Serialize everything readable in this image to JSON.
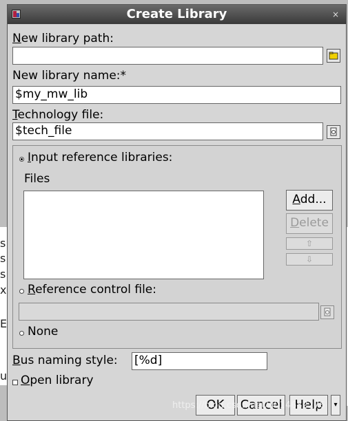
{
  "dialog": {
    "title": "Create Library",
    "close_glyph": "×",
    "new_library_path": {
      "label_first": "N",
      "label_rest": "ew library path:",
      "value": ""
    },
    "new_library_name": {
      "label": "New library name:*",
      "value": "$my_mw_lib"
    },
    "technology_file": {
      "label_first": "T",
      "label_rest": "echnology file:",
      "value": "$tech_file"
    },
    "input_reference_libraries": {
      "selected": true,
      "label_first": "I",
      "label_rest": "nput reference libraries:",
      "files_label": "Files",
      "files": [],
      "add_button": {
        "first": "A",
        "rest": "dd..."
      },
      "delete_button": {
        "first": "D",
        "rest": "elete"
      },
      "up_glyph": "⇧",
      "down_glyph": "⇩"
    },
    "reference_control_file": {
      "selected": false,
      "label_first": "R",
      "label_rest": "eference control file:",
      "value": ""
    },
    "none_option": {
      "selected": false,
      "label": "None"
    },
    "bus_naming_style": {
      "label_first": "B",
      "label_rest": "us naming style:",
      "value": "[%d]"
    },
    "open_library": {
      "checked": false,
      "label_first": "O",
      "label_rest": "pen library"
    },
    "buttons": {
      "ok": "OK",
      "cancel": "Cancel",
      "help": "Help"
    }
  },
  "background": {
    "letters": [
      "s",
      "s",
      "s",
      "x",
      "E",
      "u"
    ]
  },
  "watermark": "https://blog.csdn.net/u014682276",
  "icons": {
    "browse": "folder-icon",
    "file": "file-icon"
  }
}
